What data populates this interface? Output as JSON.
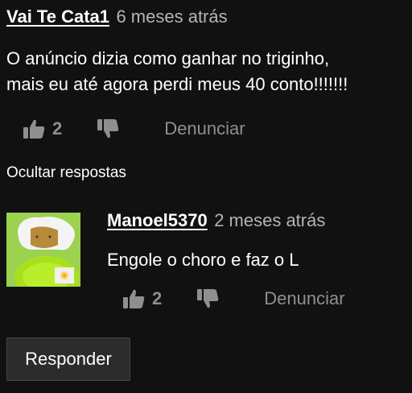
{
  "comment": {
    "author": "Vai Te Cata1",
    "timestamp": "6 meses atrás",
    "body_lines": [
      "O anúncio dizia como ganhar no triginho,",
      "mais eu até agora perdi meus 40 conto!!!!!!!"
    ],
    "likes": "2",
    "report_label": "Denunciar"
  },
  "hide_replies_label": "Ocultar respostas",
  "reply": {
    "author": "Manoel5370",
    "timestamp": "2 meses atrás",
    "body": "Engole o choro e faz o L",
    "likes": "2",
    "report_label": "Denunciar",
    "avatar_icon": "avatar-illustration"
  },
  "respond_button_label": "Responder",
  "icons": {
    "like": "thumbs-up-icon",
    "dislike": "thumbs-down-icon"
  },
  "colors": {
    "background": "#111111",
    "muted_text": "#8f8f8f",
    "timestamp": "#b4b4b4",
    "button_bg": "#2c2c2c"
  }
}
